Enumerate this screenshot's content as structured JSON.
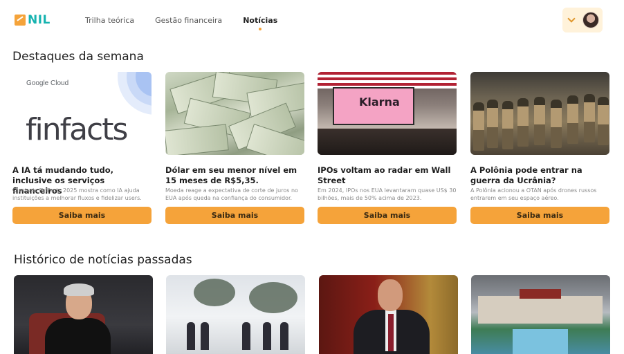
{
  "header": {
    "logo_text": "NIL",
    "nav": [
      {
        "label": "Trilha teórica",
        "active": false
      },
      {
        "label": "Gestão financeira",
        "active": false
      },
      {
        "label": "Notícias",
        "active": true
      }
    ]
  },
  "sections": {
    "highlights_title": "Destaques da semana",
    "history_title": "Histórico de notícias passadas"
  },
  "highlights": [
    {
      "title": "A IA tá mudando tudo, inclusive os serviços financeiros",
      "description": "O estudo FinFacts 2025 mostra como IA ajuda instituições a melhorar fluxos e fidelizar users.",
      "button": "Saiba mais",
      "image": {
        "brand": "Google Cloud",
        "wordmark": "finfacts"
      }
    },
    {
      "title": "Dólar em seu menor nível em 15 meses de R$5,35.",
      "description": "Moeda reage a expectativa de corte de juros no EUA após queda na confiança do consumidor.",
      "button": "Saiba mais",
      "image": {
        "subject": "money"
      }
    },
    {
      "title": "IPOs voltam ao radar em Wall Street",
      "description": "Em 2024, IPOs nos EUA levantaram quase US$ 30 bilhões, mais de 50% acima de 2023.",
      "button": "Saiba mais",
      "image": {
        "screen_text": "Klarna"
      }
    },
    {
      "title": "A Polônia pode entrar na guerra da Ucrânia?",
      "description": "A Polônia acionou a OTAN após drones russos entrarem em seu espaço aéreo.",
      "button": "Saiba mais",
      "image": {
        "subject": "soldiers"
      }
    }
  ],
  "colors": {
    "accent": "#f5a33a",
    "brand_teal": "#17b3b0",
    "user_button_bg": "#fff2da"
  },
  "icons": {
    "user_menu": "chevron-down-icon",
    "avatar": "avatar"
  }
}
